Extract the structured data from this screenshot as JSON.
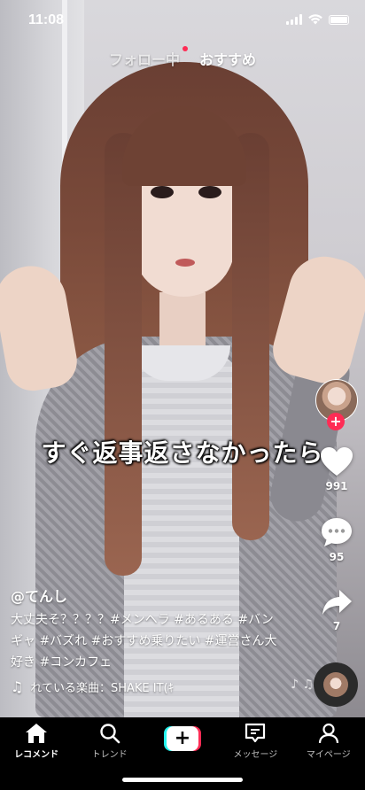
{
  "status_bar": {
    "time": "11:08"
  },
  "top_tabs": [
    {
      "label": "フォロー中",
      "has_dot": true
    },
    {
      "label": "おすすめ",
      "active": true
    }
  ],
  "video": {
    "caption": "すぐ返事返さなかったら"
  },
  "actions": {
    "likes": "991",
    "comments": "95",
    "shares": "7"
  },
  "post": {
    "username": "@てんし",
    "description_lines": [
      "大丈夫そ？？？？#メンヘラ #あるある #バン",
      "ギャ #バズれ #おすすめ乗りたい #運営さん大",
      "好き #コンカフェ"
    ],
    "music": "れている楽曲：SHAKE IT(ｷ"
  },
  "nav": {
    "items": [
      {
        "label": "レコメンド",
        "icon": "home-icon",
        "active": true
      },
      {
        "label": "トレンド",
        "icon": "search-icon"
      },
      {
        "label": "",
        "icon": "create-plus-icon"
      },
      {
        "label": "メッセージ",
        "icon": "message-icon"
      },
      {
        "label": "マイページ",
        "icon": "profile-icon"
      }
    ]
  },
  "colors": {
    "accent": "#fe2c55",
    "cyan": "#25f4ee",
    "nav_bg": "#000000"
  }
}
